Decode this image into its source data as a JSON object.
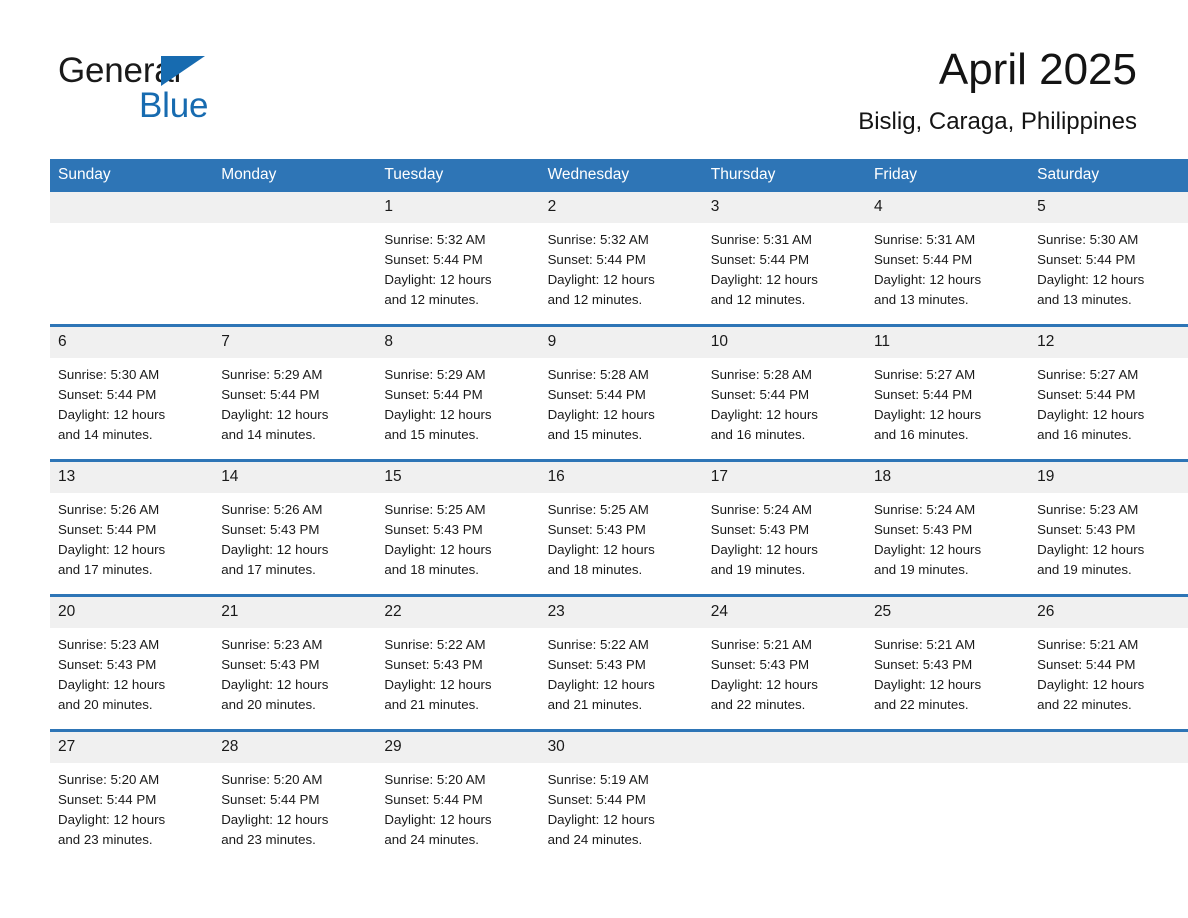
{
  "brand": {
    "name_part1": "General",
    "name_part2": "Blue",
    "logo_icon": "triangle-icon",
    "accent_color": "#176bb0"
  },
  "header": {
    "month_title": "April 2025",
    "location": "Bislig, Caraga, Philippines"
  },
  "theme": {
    "header_blue": "#2e75b6",
    "daynum_band": "#f0f0f0",
    "text": "#1a1a1a"
  },
  "calendar": {
    "weekday_headers": [
      "Sunday",
      "Monday",
      "Tuesday",
      "Wednesday",
      "Thursday",
      "Friday",
      "Saturday"
    ],
    "weeks": [
      [
        {
          "day": "",
          "empty": true,
          "sunrise": "",
          "sunset": "",
          "daylight_line1": "",
          "daylight_line2": ""
        },
        {
          "day": "",
          "empty": true,
          "sunrise": "",
          "sunset": "",
          "daylight_line1": "",
          "daylight_line2": ""
        },
        {
          "day": "1",
          "empty": false,
          "sunrise": "Sunrise: 5:32 AM",
          "sunset": "Sunset: 5:44 PM",
          "daylight_line1": "Daylight: 12 hours",
          "daylight_line2": "and 12 minutes."
        },
        {
          "day": "2",
          "empty": false,
          "sunrise": "Sunrise: 5:32 AM",
          "sunset": "Sunset: 5:44 PM",
          "daylight_line1": "Daylight: 12 hours",
          "daylight_line2": "and 12 minutes."
        },
        {
          "day": "3",
          "empty": false,
          "sunrise": "Sunrise: 5:31 AM",
          "sunset": "Sunset: 5:44 PM",
          "daylight_line1": "Daylight: 12 hours",
          "daylight_line2": "and 12 minutes."
        },
        {
          "day": "4",
          "empty": false,
          "sunrise": "Sunrise: 5:31 AM",
          "sunset": "Sunset: 5:44 PM",
          "daylight_line1": "Daylight: 12 hours",
          "daylight_line2": "and 13 minutes."
        },
        {
          "day": "5",
          "empty": false,
          "sunrise": "Sunrise: 5:30 AM",
          "sunset": "Sunset: 5:44 PM",
          "daylight_line1": "Daylight: 12 hours",
          "daylight_line2": "and 13 minutes."
        }
      ],
      [
        {
          "day": "6",
          "empty": false,
          "sunrise": "Sunrise: 5:30 AM",
          "sunset": "Sunset: 5:44 PM",
          "daylight_line1": "Daylight: 12 hours",
          "daylight_line2": "and 14 minutes."
        },
        {
          "day": "7",
          "empty": false,
          "sunrise": "Sunrise: 5:29 AM",
          "sunset": "Sunset: 5:44 PM",
          "daylight_line1": "Daylight: 12 hours",
          "daylight_line2": "and 14 minutes."
        },
        {
          "day": "8",
          "empty": false,
          "sunrise": "Sunrise: 5:29 AM",
          "sunset": "Sunset: 5:44 PM",
          "daylight_line1": "Daylight: 12 hours",
          "daylight_line2": "and 15 minutes."
        },
        {
          "day": "9",
          "empty": false,
          "sunrise": "Sunrise: 5:28 AM",
          "sunset": "Sunset: 5:44 PM",
          "daylight_line1": "Daylight: 12 hours",
          "daylight_line2": "and 15 minutes."
        },
        {
          "day": "10",
          "empty": false,
          "sunrise": "Sunrise: 5:28 AM",
          "sunset": "Sunset: 5:44 PM",
          "daylight_line1": "Daylight: 12 hours",
          "daylight_line2": "and 16 minutes."
        },
        {
          "day": "11",
          "empty": false,
          "sunrise": "Sunrise: 5:27 AM",
          "sunset": "Sunset: 5:44 PM",
          "daylight_line1": "Daylight: 12 hours",
          "daylight_line2": "and 16 minutes."
        },
        {
          "day": "12",
          "empty": false,
          "sunrise": "Sunrise: 5:27 AM",
          "sunset": "Sunset: 5:44 PM",
          "daylight_line1": "Daylight: 12 hours",
          "daylight_line2": "and 16 minutes."
        }
      ],
      [
        {
          "day": "13",
          "empty": false,
          "sunrise": "Sunrise: 5:26 AM",
          "sunset": "Sunset: 5:44 PM",
          "daylight_line1": "Daylight: 12 hours",
          "daylight_line2": "and 17 minutes."
        },
        {
          "day": "14",
          "empty": false,
          "sunrise": "Sunrise: 5:26 AM",
          "sunset": "Sunset: 5:43 PM",
          "daylight_line1": "Daylight: 12 hours",
          "daylight_line2": "and 17 minutes."
        },
        {
          "day": "15",
          "empty": false,
          "sunrise": "Sunrise: 5:25 AM",
          "sunset": "Sunset: 5:43 PM",
          "daylight_line1": "Daylight: 12 hours",
          "daylight_line2": "and 18 minutes."
        },
        {
          "day": "16",
          "empty": false,
          "sunrise": "Sunrise: 5:25 AM",
          "sunset": "Sunset: 5:43 PM",
          "daylight_line1": "Daylight: 12 hours",
          "daylight_line2": "and 18 minutes."
        },
        {
          "day": "17",
          "empty": false,
          "sunrise": "Sunrise: 5:24 AM",
          "sunset": "Sunset: 5:43 PM",
          "daylight_line1": "Daylight: 12 hours",
          "daylight_line2": "and 19 minutes."
        },
        {
          "day": "18",
          "empty": false,
          "sunrise": "Sunrise: 5:24 AM",
          "sunset": "Sunset: 5:43 PM",
          "daylight_line1": "Daylight: 12 hours",
          "daylight_line2": "and 19 minutes."
        },
        {
          "day": "19",
          "empty": false,
          "sunrise": "Sunrise: 5:23 AM",
          "sunset": "Sunset: 5:43 PM",
          "daylight_line1": "Daylight: 12 hours",
          "daylight_line2": "and 19 minutes."
        }
      ],
      [
        {
          "day": "20",
          "empty": false,
          "sunrise": "Sunrise: 5:23 AM",
          "sunset": "Sunset: 5:43 PM",
          "daylight_line1": "Daylight: 12 hours",
          "daylight_line2": "and 20 minutes."
        },
        {
          "day": "21",
          "empty": false,
          "sunrise": "Sunrise: 5:23 AM",
          "sunset": "Sunset: 5:43 PM",
          "daylight_line1": "Daylight: 12 hours",
          "daylight_line2": "and 20 minutes."
        },
        {
          "day": "22",
          "empty": false,
          "sunrise": "Sunrise: 5:22 AM",
          "sunset": "Sunset: 5:43 PM",
          "daylight_line1": "Daylight: 12 hours",
          "daylight_line2": "and 21 minutes."
        },
        {
          "day": "23",
          "empty": false,
          "sunrise": "Sunrise: 5:22 AM",
          "sunset": "Sunset: 5:43 PM",
          "daylight_line1": "Daylight: 12 hours",
          "daylight_line2": "and 21 minutes."
        },
        {
          "day": "24",
          "empty": false,
          "sunrise": "Sunrise: 5:21 AM",
          "sunset": "Sunset: 5:43 PM",
          "daylight_line1": "Daylight: 12 hours",
          "daylight_line2": "and 22 minutes."
        },
        {
          "day": "25",
          "empty": false,
          "sunrise": "Sunrise: 5:21 AM",
          "sunset": "Sunset: 5:43 PM",
          "daylight_line1": "Daylight: 12 hours",
          "daylight_line2": "and 22 minutes."
        },
        {
          "day": "26",
          "empty": false,
          "sunrise": "Sunrise: 5:21 AM",
          "sunset": "Sunset: 5:44 PM",
          "daylight_line1": "Daylight: 12 hours",
          "daylight_line2": "and 22 minutes."
        }
      ],
      [
        {
          "day": "27",
          "empty": false,
          "sunrise": "Sunrise: 5:20 AM",
          "sunset": "Sunset: 5:44 PM",
          "daylight_line1": "Daylight: 12 hours",
          "daylight_line2": "and 23 minutes."
        },
        {
          "day": "28",
          "empty": false,
          "sunrise": "Sunrise: 5:20 AM",
          "sunset": "Sunset: 5:44 PM",
          "daylight_line1": "Daylight: 12 hours",
          "daylight_line2": "and 23 minutes."
        },
        {
          "day": "29",
          "empty": false,
          "sunrise": "Sunrise: 5:20 AM",
          "sunset": "Sunset: 5:44 PM",
          "daylight_line1": "Daylight: 12 hours",
          "daylight_line2": "and 24 minutes."
        },
        {
          "day": "30",
          "empty": false,
          "sunrise": "Sunrise: 5:19 AM",
          "sunset": "Sunset: 5:44 PM",
          "daylight_line1": "Daylight: 12 hours",
          "daylight_line2": "and 24 minutes."
        },
        {
          "day": "",
          "empty": true,
          "sunrise": "",
          "sunset": "",
          "daylight_line1": "",
          "daylight_line2": ""
        },
        {
          "day": "",
          "empty": true,
          "sunrise": "",
          "sunset": "",
          "daylight_line1": "",
          "daylight_line2": ""
        },
        {
          "day": "",
          "empty": true,
          "sunrise": "",
          "sunset": "",
          "daylight_line1": "",
          "daylight_line2": ""
        }
      ]
    ]
  }
}
